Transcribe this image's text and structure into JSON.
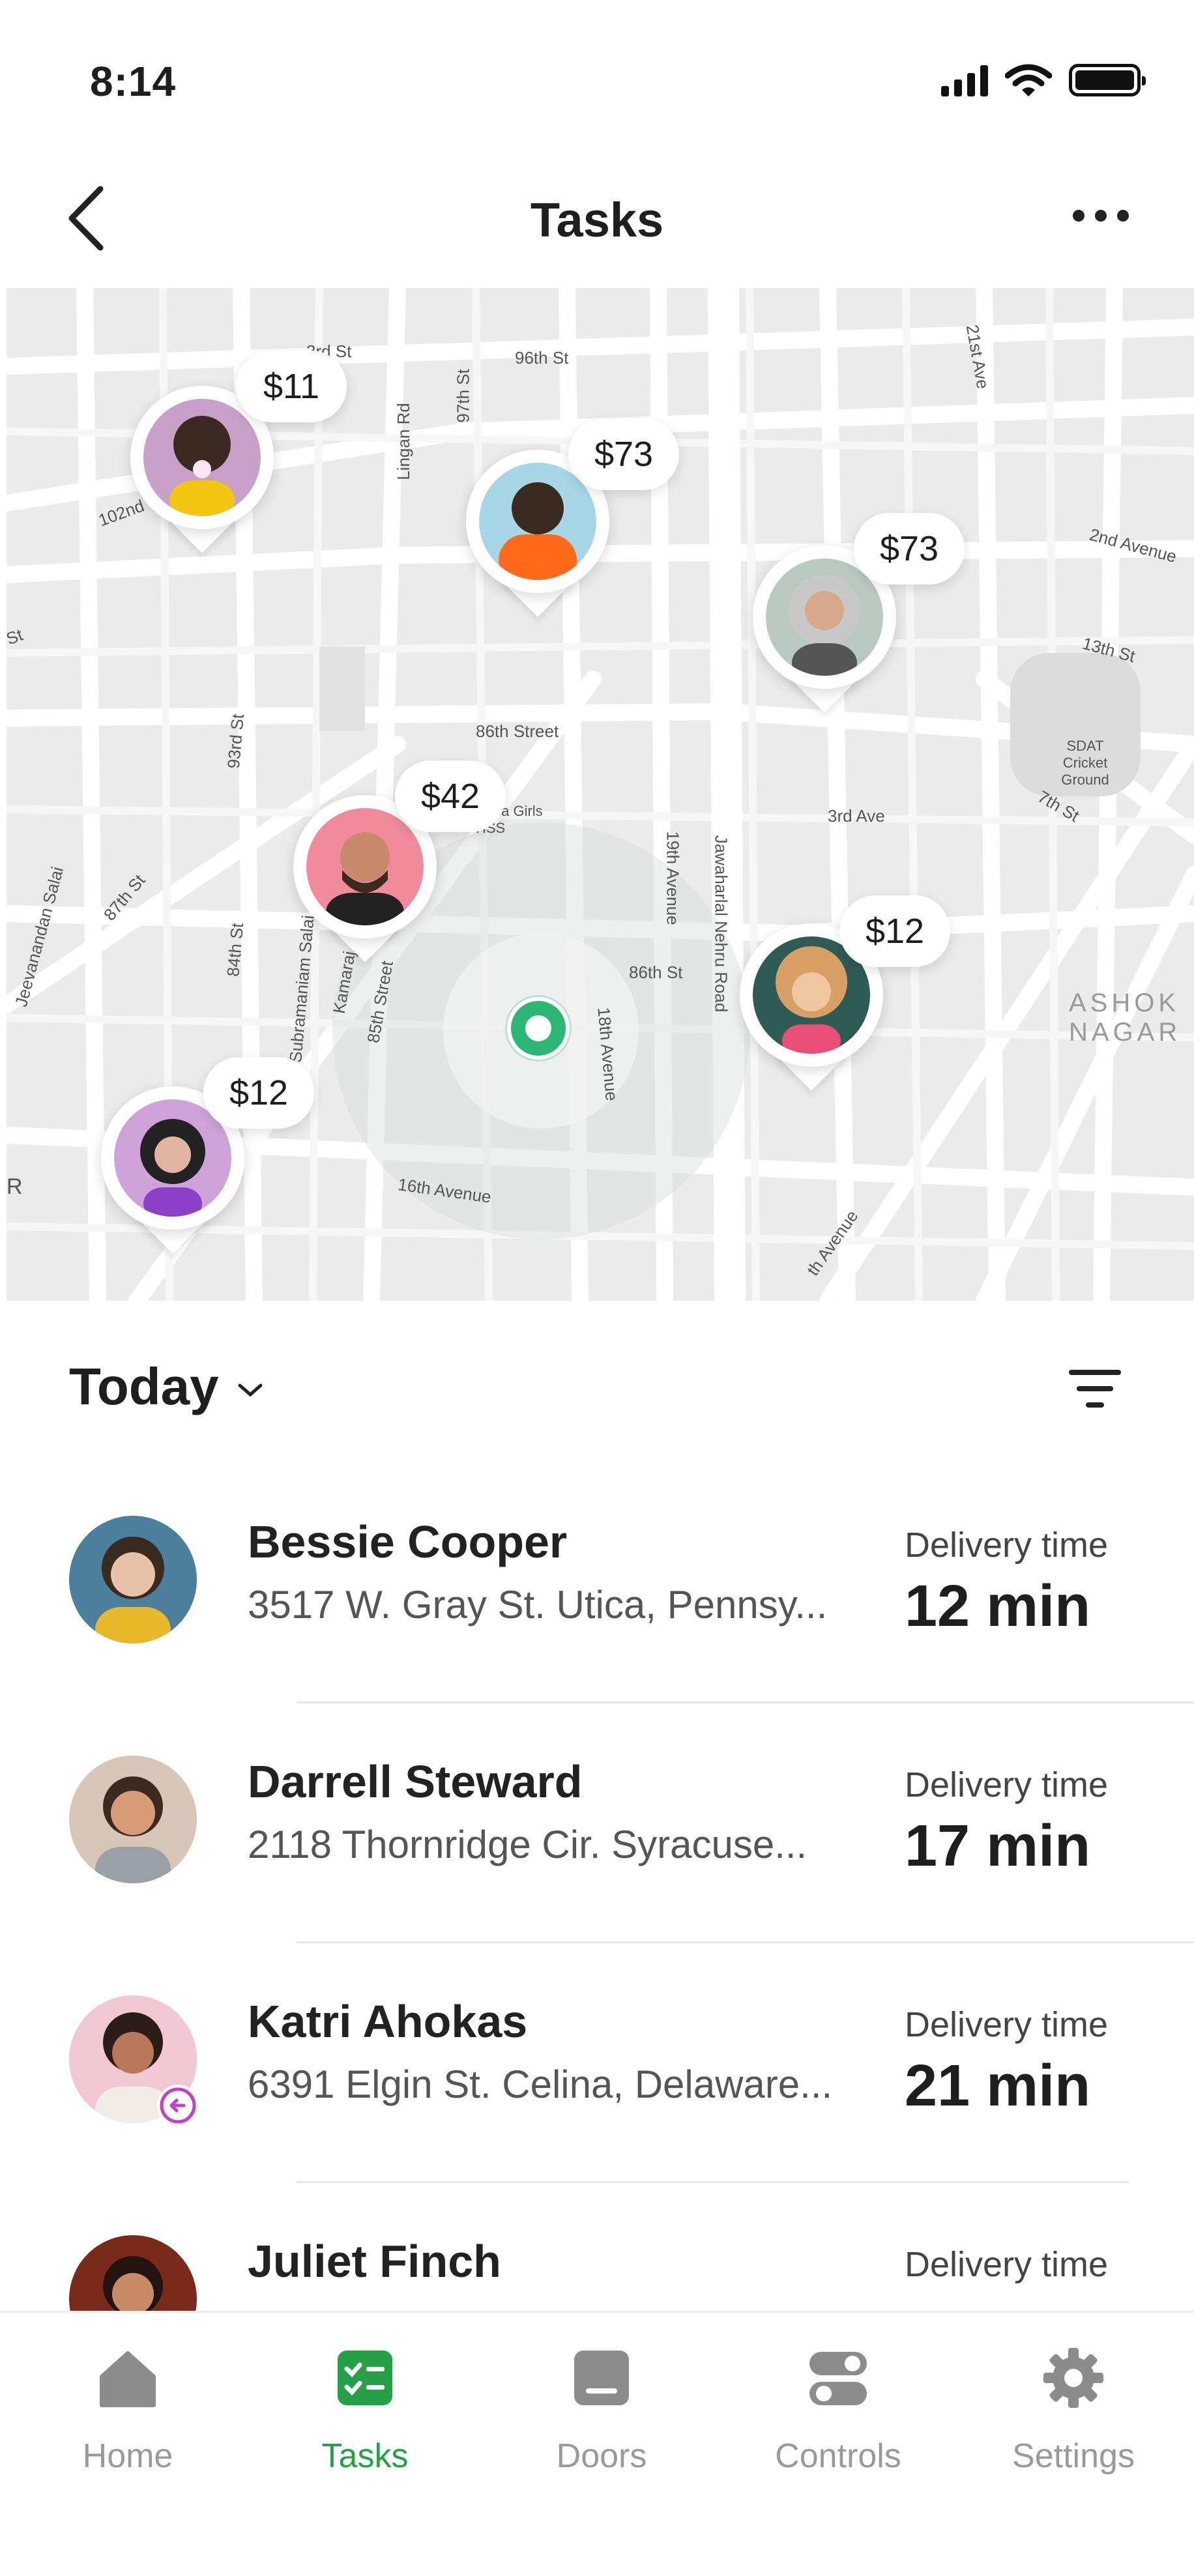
{
  "status_bar": {
    "time": "8:14"
  },
  "header": {
    "title": "Tasks"
  },
  "map": {
    "pins": [
      {
        "price": "$11"
      },
      {
        "price": "$73"
      },
      {
        "price": "$73"
      },
      {
        "price": "$42"
      },
      {
        "price": "$12"
      },
      {
        "price": "$12"
      }
    ],
    "labels": {
      "st3rd": "3rd St",
      "st96": "96th St",
      "st97": "97th St",
      "lingan": "Lingan Rd",
      "st102": "102nd",
      "st21": "21st Ave",
      "ave2nd": "2nd Avenue",
      "st13": "13th St",
      "street86": "86th Street",
      "cricket": "SDAT Cricket Ground",
      "st7": "7th St",
      "st93": "93rd St",
      "ave3": "3rd Ave",
      "hss": "Ojala Girls HSS",
      "ave19": "19th Avenue",
      "jawaharlal": "Jawaharlal Nehru Road",
      "jeevanandan": "Jeevanandan Salai",
      "st87": "87th St",
      "st84": "84th St",
      "subramaniam": "Subramaniam Salai",
      "kamaraj": "Kamaraj",
      "street85": "85th Street",
      "st86": "86th St",
      "ave18": "18th Avenue",
      "ashok": "ASHOK NAGAR",
      "ave16": "16th Avenue",
      "avenue_br": "th Avenue",
      "r": "R",
      "st_left": "St"
    }
  },
  "list": {
    "section_title": "Today",
    "delivery_label": "Delivery time",
    "tasks": [
      {
        "name": "Bessie Cooper",
        "address": "3517 W. Gray St. Utica, Pennsy...",
        "delivery_time": "12 min"
      },
      {
        "name": "Darrell Steward",
        "address": "2118 Thornridge Cir. Syracuse...",
        "delivery_time": "17 min"
      },
      {
        "name": "Katri Ahokas",
        "address": "6391 Elgin St. Celina, Delaware...",
        "delivery_time": "21 min"
      },
      {
        "name": "Juliet Finch",
        "address": "",
        "delivery_time": ""
      }
    ]
  },
  "tabbar": {
    "active_color": "#26a046",
    "inactive_color": "#9a9a9a",
    "tabs": [
      {
        "label": "Home",
        "icon": "home-icon"
      },
      {
        "label": "Tasks",
        "icon": "tasks-icon"
      },
      {
        "label": "Doors",
        "icon": "doors-icon"
      },
      {
        "label": "Controls",
        "icon": "controls-icon"
      },
      {
        "label": "Settings",
        "icon": "settings-icon"
      }
    ]
  }
}
